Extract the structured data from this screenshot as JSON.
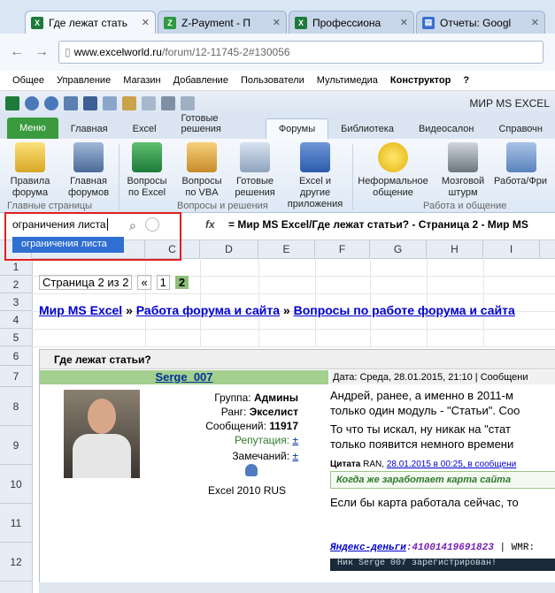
{
  "browser": {
    "tabs": [
      {
        "label": "Где лежат стать",
        "active": true,
        "icon_color": "#1d7a3a"
      },
      {
        "label": "Z-Payment - П",
        "active": false,
        "icon_color": "#2e9a42"
      },
      {
        "label": "Профессиона",
        "active": false,
        "icon_color": "#1d7a3a"
      },
      {
        "label": "Отчеты: Googl",
        "active": false,
        "icon_color": "#3a6fd0"
      }
    ],
    "url_domain": "www.excelworld.ru",
    "url_path": "/forum/12-11745-2#130056"
  },
  "site_menu": {
    "items": [
      "Общее",
      "Управление",
      "Магазин",
      "Добавление",
      "Пользователи",
      "Мультимедиа"
    ],
    "bold_item": "Конструктор",
    "help": "?"
  },
  "qat": {
    "title": "МИР MS EXCEL"
  },
  "ribbon": {
    "menu_tab": "Меню",
    "tabs": [
      "Главная",
      "Excel",
      "Готовые решения",
      "Форумы",
      "Библиотека",
      "Видеосалон",
      "Справочн"
    ],
    "active_tab": "Форумы",
    "buttons": [
      {
        "line1": "Правила",
        "line2": "форума"
      },
      {
        "line1": "Главная",
        "line2": "форумов"
      },
      {
        "line1": "Вопросы",
        "line2": "по Excel"
      },
      {
        "line1": "Вопросы",
        "line2": "по VBA"
      },
      {
        "line1": "Готовые",
        "line2": "решения"
      },
      {
        "line1": "Excel и другие",
        "line2": "приложения"
      },
      {
        "line1": "Неформальное",
        "line2": "общение"
      },
      {
        "line1": "Мозговой",
        "line2": "штурм"
      },
      {
        "line1": "Работа/Фри",
        "line2": ""
      }
    ],
    "groups": [
      "Главные страницы",
      "Вопросы и решения",
      "Работа и общение"
    ]
  },
  "formula_bar": {
    "namebox_value": "ограничения листа",
    "fx": "fx",
    "formula": "= Мир MS Excel/Где лежат статьи? - Страница 2 - Мир MS"
  },
  "dropdown": {
    "suggestion": "ограничения листа"
  },
  "grid": {
    "columns": [
      "C",
      "D",
      "E",
      "F",
      "G",
      "H",
      "I"
    ],
    "rows": [
      "1",
      "2",
      "3",
      "4",
      "5",
      "6",
      "7",
      "8",
      "9",
      "10",
      "11",
      "12"
    ]
  },
  "pager": {
    "text": "Страница 2 из 2",
    "prev": "«",
    "page1": "1",
    "page2": "2"
  },
  "breadcrumbs": {
    "items": [
      "Мир MS Excel",
      "Работа форума и сайта",
      "Вопросы по работе форума и сайта"
    ],
    "sep": "»"
  },
  "post": {
    "topic": "Где лежат статьи?",
    "author": "Serge_007",
    "header": "Дата: Среда, 28.01.2015, 21:10 | Сообщени",
    "group_label": "Группа:",
    "group_value": "Админы",
    "rank_label": "Ранг:",
    "rank_value": "Экселист",
    "msgs_label": "Сообщений:",
    "msgs_value": "11917",
    "reputation_label": "Репутация:",
    "reputation_value": "±",
    "remarks_label": "Замечаний:",
    "remarks_value": "±",
    "version": "Excel 2010 RUS",
    "body_lines": [
      "Андрей, ранее, а именно в 2011-м",
      "только один модуль - \"Статьи\". Соо",
      "То что ты искал, ну никак на \"стат",
      "только появится немного времени"
    ],
    "quote_label": "Цитата",
    "quote_user": "RAN,",
    "quote_link": "28.01.2015 в 00:25, в сообщени",
    "quote_text": "Когда же заработает карта сайта",
    "after_quote": "Если бы карта работала сейчас, то",
    "sig_label": "Яндекс-деньги",
    "sig_value": ":41001419691823",
    "sig_more": "| WMR:",
    "banner": "Ник Serge 007 зарегистрирован!"
  }
}
